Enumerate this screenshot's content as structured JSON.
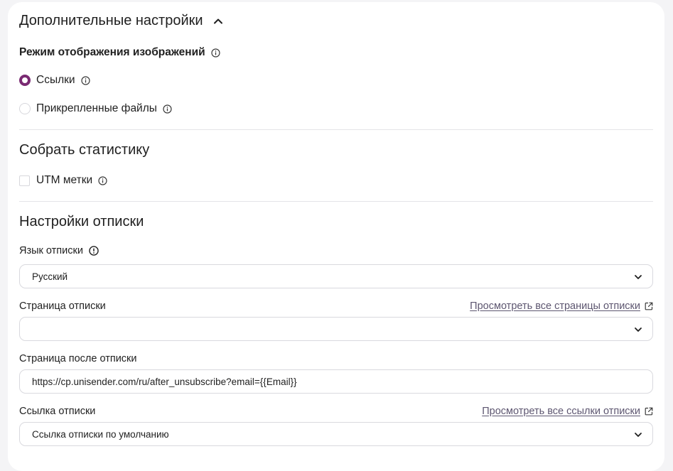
{
  "advanced": {
    "title": "Дополнительные настройки",
    "image_mode": {
      "label": "Режим отображения изображений",
      "options": [
        {
          "label": "Ссылки",
          "selected": true
        },
        {
          "label": "Прикрепленные файлы",
          "selected": false
        }
      ]
    }
  },
  "stats": {
    "title": "Собрать статистику",
    "utm_label": "UTM метки",
    "utm_checked": false
  },
  "unsubscribe": {
    "title": "Настройки отписки",
    "language": {
      "label": "Язык отписки",
      "value": "Русский"
    },
    "page": {
      "label": "Страница отписки",
      "link": "Просмотреть все страницы отписки",
      "value": ""
    },
    "after_page": {
      "label": "Страница после отписки",
      "value": "https://cp.unisender.com/ru/after_unsubscribe?email={{Email}}"
    },
    "link": {
      "label": "Ссылка отписки",
      "link": "Просмотреть все ссылки отписки",
      "value": "Ссылка отписки по умолчанию"
    }
  },
  "colors": {
    "accent": "#7a2a72",
    "link": "#5d5670"
  },
  "icons": [
    "chevron-up-icon",
    "info-icon",
    "alert-info-icon",
    "external-link-icon",
    "chevron-down-icon"
  ]
}
